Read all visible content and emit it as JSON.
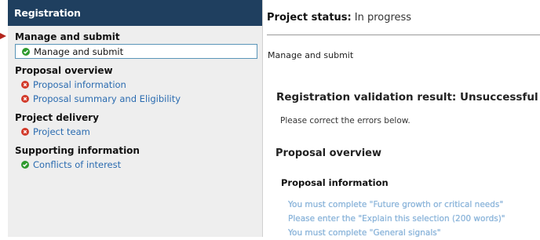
{
  "sidebar": {
    "header": "Registration",
    "sections": [
      {
        "heading": "Manage and submit",
        "items": [
          {
            "label": "Manage and submit",
            "status": "complete",
            "selected": true
          }
        ]
      },
      {
        "heading": "Proposal overview",
        "items": [
          {
            "label": "Proposal information",
            "status": "error",
            "selected": false
          },
          {
            "label": "Proposal summary and Eligibility",
            "status": "error",
            "selected": false
          }
        ]
      },
      {
        "heading": "Project delivery",
        "items": [
          {
            "label": "Project team",
            "status": "error",
            "selected": false
          }
        ]
      },
      {
        "heading": "Supporting information",
        "items": [
          {
            "label": "Conflicts of interest",
            "status": "complete",
            "selected": false
          }
        ]
      }
    ]
  },
  "main": {
    "status_label": "Project status:",
    "status_value": "In progress",
    "page_title": "Manage and submit",
    "validation_title": "Registration validation result: Unsuccessful",
    "validation_message": "Please correct the errors below.",
    "section_title": "Proposal overview",
    "subsection_title": "Proposal information",
    "errors": [
      "You must complete \"Future growth or critical needs\"",
      "Please enter the \"Explain this selection (200 words)\"",
      "You must complete \"General signals\""
    ]
  },
  "colors": {
    "header_bg": "#1f3f5f",
    "complete": "#2e9a2e",
    "error": "#d23a2a",
    "link": "#2a6bb0",
    "error_text": "#8fb8dd",
    "arrow": "#b3241c"
  },
  "icons": {
    "complete": "check-circle-icon",
    "error": "x-circle-icon"
  }
}
